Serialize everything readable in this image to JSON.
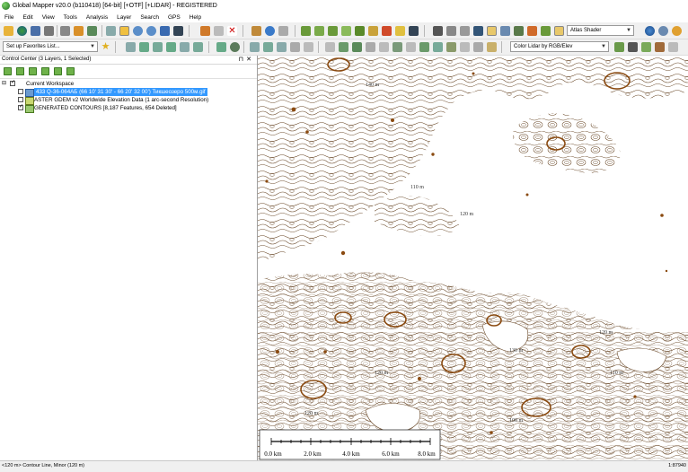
{
  "window": {
    "title": "Global Mapper v20.0 (b110418) [64-bit] [+OTF] [+LIDAR] - REGISTERED"
  },
  "menu": [
    "File",
    "Edit",
    "View",
    "Tools",
    "Analysis",
    "Layer",
    "Search",
    "GPS",
    "Help"
  ],
  "toolbar": {
    "shader_dropdown": "Atlas Shader",
    "favorites_dropdown": "Set up Favorites List...",
    "lidar_dropdown": "Color Lidar by RGB/Elev"
  },
  "control_center": {
    "header": "Control Center (3 Layers, 1 Selected)",
    "workspace": "Current Workspace",
    "layers": [
      {
        "label": "433 Q-36-064АБ (66 10' 31 30' - 66 20' 32 00') Тикшеозеро 500м.gif",
        "checked": false,
        "selected": true
      },
      {
        "label": "ASTER GDEM v2 Worldwide Elevation Data (1 arc-second Resolution)",
        "checked": false,
        "selected": false
      },
      {
        "label": "GENERATED CONTOURS [8,187 Features, 654 Deleted]",
        "checked": true,
        "selected": false
      }
    ]
  },
  "map": {
    "scale_labels": [
      "0.0 km",
      "2.0 km",
      "4.0 km",
      "6.0 km",
      "8.0 km"
    ],
    "contour_labels": [
      "110 m",
      "120 m",
      "120 m",
      "110 m",
      "100 m",
      "120 m",
      "130 m",
      "140 m",
      "120 m"
    ],
    "colors": {
      "contour_minor": "#6b4a2a",
      "contour_major": "#8a4a10",
      "background": "#ffffff"
    }
  },
  "status": {
    "left": "<120 m> Contour Line, Minor (120 m)",
    "right": "1:87940"
  }
}
